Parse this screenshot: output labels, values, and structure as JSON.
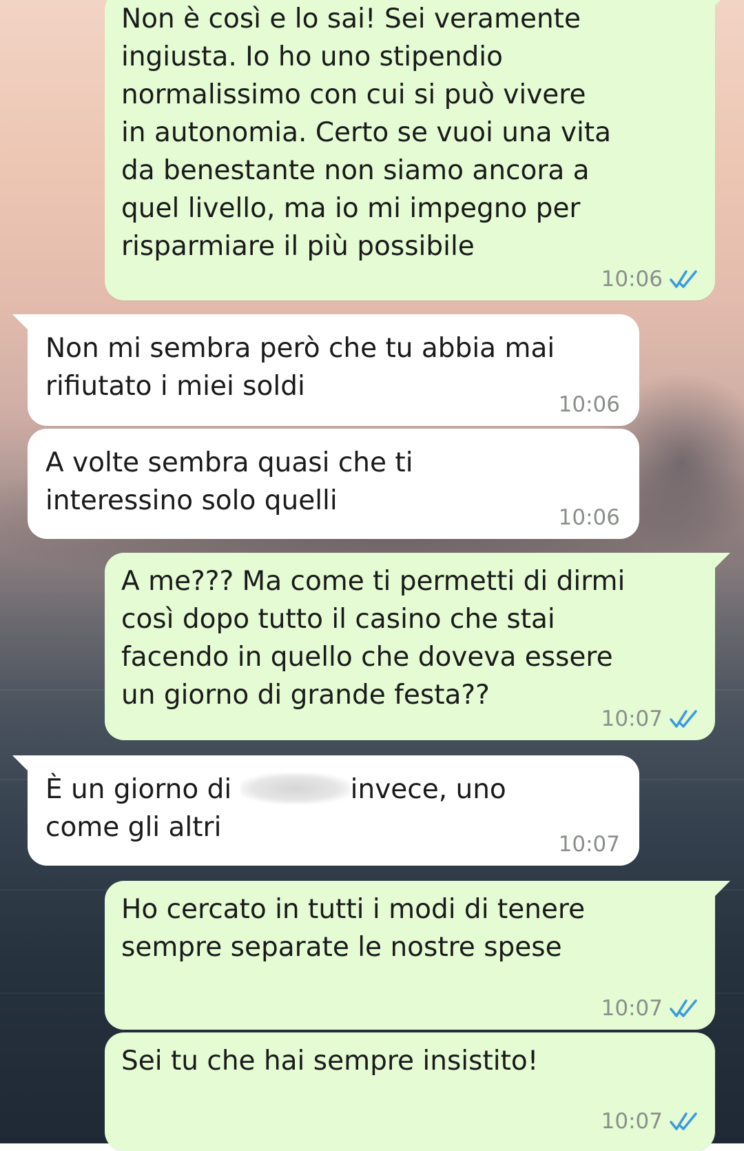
{
  "messages": [
    {
      "direction": "out",
      "text": "Non è così e lo sai! Sei veramente\ningiusta. Io ho uno stipendio\nnormalissimo con cui si può vivere\nin autonomia. Certo se vuoi una vita\nda benestante non siamo ancora a\nquel livello, ma io mi impegno per\nrisparmiare il più possibile",
      "time": "10:06",
      "status": "read"
    },
    {
      "direction": "in",
      "text": "Non mi sembra però che tu abbia mai\nrifiutato i miei soldi",
      "time": "10:06"
    },
    {
      "direction": "in",
      "text": "A volte sembra quasi che ti\ninteressino solo quelli",
      "time": "10:06"
    },
    {
      "direction": "out",
      "text": "A me??? Ma come ti permetti di dirmi\ncosì dopo tutto il casino che stai\nfacendo in quello che doveva essere\nun giorno di grande festa??",
      "time": "10:07",
      "status": "read"
    },
    {
      "direction": "in",
      "text_before": "È un giorno di ",
      "text_after": "invece, uno",
      "text_line2": "come gli altri",
      "time": "10:07",
      "redacted": true
    },
    {
      "direction": "out",
      "text": "Ho cercato in tutti i modi di tenere\nsempre separate le nostre spese",
      "time": "10:07",
      "status": "read"
    },
    {
      "direction": "out",
      "text": "Sei tu che hai sempre insistito!",
      "time": "10:07",
      "status": "read"
    }
  ],
  "colors": {
    "outgoing_bubble": "#e4fbd4",
    "incoming_bubble": "#ffffff",
    "read_ticks": "#3a9bdc",
    "timestamp": "#8a8f8a"
  },
  "icons": {
    "read_status": "double-check-icon"
  }
}
